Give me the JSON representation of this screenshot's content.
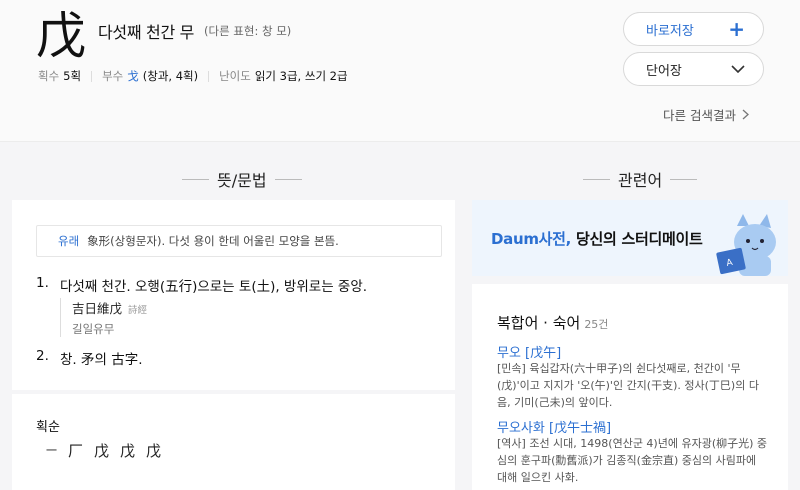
{
  "header": {
    "hanja": "戊",
    "meaning": "다섯째 천간 무",
    "alt_expression": "(다른 표현: 창 모)",
    "stroke_label": "획수",
    "stroke_value": "5획",
    "radical_label": "부수",
    "radical_char": "戈",
    "radical_detail": "(창과, 4획)",
    "difficulty_label": "난이도",
    "difficulty_value": "읽기 3급, 쓰기 2급",
    "save_button": "바로저장",
    "vocab_button": "단어장",
    "other_results": "다른 검색결과"
  },
  "sections": {
    "meaning_title": "뜻/문법",
    "related_title": "관련어"
  },
  "meaning": {
    "origin_label": "유래",
    "origin_text": "象形(상형문자). 다섯 용이 한데 어울린 모양을 본뜸.",
    "definitions": [
      {
        "num": "1.",
        "text": "다섯째 천간. 오행(五行)으로는 토(土), 방위로는 중앙.",
        "example_hanja": "吉日維戊",
        "example_source": "詩經",
        "example_reading": "길일유무"
      },
      {
        "num": "2.",
        "text": "창. 矛의 古字."
      }
    ]
  },
  "strokes": {
    "title": "획순",
    "steps": [
      "一",
      "厂",
      "戊",
      "戊",
      "戊"
    ]
  },
  "banner": {
    "brand": "Daum사전,",
    "text": " 당신의 스터디메이트"
  },
  "related": {
    "heading": "복합어 · 숙어",
    "count": "25건",
    "items": [
      {
        "term": "무오 [戊午]",
        "desc": "[민속] 육십갑자(六十甲子)의 쉰다섯째로, 천간이 '무(戊)'이고 지지가 '오(午)'인 간지(干支). 정사(丁巳)의 다음, 기미(己未)의 앞이다."
      },
      {
        "term": "무오사화 [戊午士禍]",
        "desc": "[역사] 조선 시대, 1498(연산군 4)년에 유자광(柳子光) 중심의 훈구파(勳舊派)가 김종직(金宗直) 중심의 사림파에 대해 일으킨 사화."
      }
    ]
  },
  "colors": {
    "accent": "#2b6fd1",
    "background": "#f5f5f7",
    "banner_bg": "#eef5fd"
  },
  "icons": [
    "plus-icon",
    "chevron-down-icon",
    "chevron-right-icon",
    "cat-mascot-icon"
  ]
}
